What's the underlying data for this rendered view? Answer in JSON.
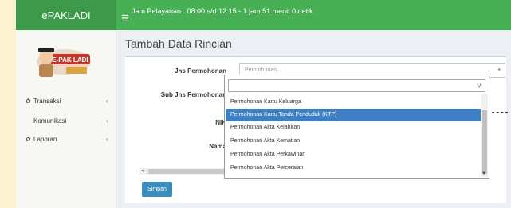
{
  "header": {
    "brand": "ePAKLADI",
    "menu_icon": "hamburger-icon",
    "clock_text": "Jam Pelayanan : 08:00 s/d 12:15 - 1 jam 51 menit 0 detik"
  },
  "sidebar": {
    "logo_text": "E-PAK LADI",
    "items": [
      {
        "label": "Transaksi",
        "icon": "gear-icon"
      },
      {
        "label": "Komunikasi",
        "icon": ""
      },
      {
        "label": "Laporan",
        "icon": "gear-icon"
      }
    ]
  },
  "page": {
    "title": "Tambah Data Rincian"
  },
  "form": {
    "labels": {
      "jns_permohonan": "Jns Permohonan",
      "sub_jns_permohonan": "Sub Jns Permohonan",
      "nik": "NIK",
      "nama": "Nama"
    },
    "select_placeholder": "Permohonan...",
    "submit_label": "Simpan"
  },
  "dropdown": {
    "search_value": "",
    "options": [
      "Permohonan Kartu Keluarga",
      "Permohonan Kartu Tanda Penduduk (KTP)",
      "Permohonan Akta Kelahiran",
      "Permohonan Akta Kematian",
      "Permohonan Akta Perkawinan",
      "Permohonan Akta Perceraian"
    ],
    "selected_index": 1
  },
  "colors": {
    "header_green": "#47b055",
    "brand_green": "#3c9a4a",
    "selected_blue": "#3d7fc2",
    "button_blue": "#3c8dbc"
  }
}
